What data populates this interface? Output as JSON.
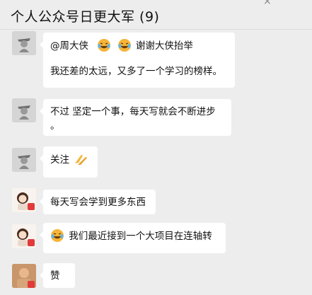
{
  "header": {
    "title": "个人公众号日更大军 (9)"
  },
  "messages": [
    {
      "avatar": "old-man-sketch",
      "line1_mention": "@周大侠",
      "line1_text": "谢谢大侠抬举",
      "line2": "我还差的太远，又多了一个学习的榜样。"
    },
    {
      "avatar": "old-man-sketch",
      "line1": "不过  坚定一个事，每天写就会不断进步",
      "line2": "。"
    },
    {
      "avatar": "old-man-sketch",
      "text": "关注"
    },
    {
      "avatar": "doll-with-badge",
      "text": "每天写会学到更多东西"
    },
    {
      "avatar": "doll-with-badge",
      "text": "我们最近接到一个大项目在连轴转"
    },
    {
      "avatar": "photo-person",
      "text": "赞"
    }
  ],
  "icons": {
    "laugh_cry_emoji": "laugh-cry-emoji",
    "clap_emoji": "clapping-hands-emoji"
  },
  "colors": {
    "bubble": "#ffffff",
    "background": "#ededed",
    "emoji_face": "#f5b53a"
  }
}
